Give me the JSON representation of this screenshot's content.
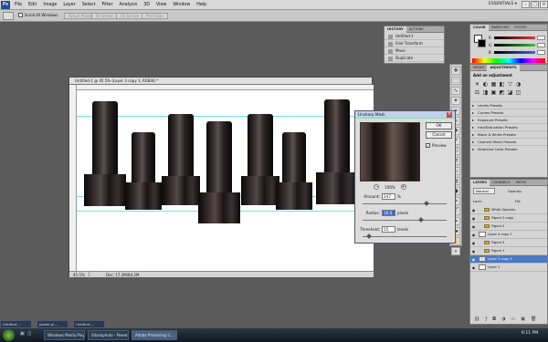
{
  "menubar": {
    "items": [
      "File",
      "Edit",
      "Image",
      "Layer",
      "Select",
      "Filter",
      "Analysis",
      "3D",
      "View",
      "Window",
      "Help"
    ],
    "workspace": "ESSENTIALS ▾"
  },
  "options": {
    "scroll_all": "Scroll All Windows",
    "buttons": [
      "Actual Pixels",
      "Fit Screen",
      "Fill Screen",
      "Print Size"
    ]
  },
  "history": {
    "tabs": [
      "HISTORY",
      "ACTIONS"
    ],
    "rows": [
      "Untitled-1",
      "Free Transform",
      "Move",
      "Duplicate"
    ]
  },
  "color_panel": {
    "tabs": [
      "COLOR",
      "SWATCHES",
      "STYLES"
    ],
    "channels": [
      {
        "label": "R",
        "color": "#e23b3b"
      },
      {
        "label": "G",
        "color": "#3bbf3b"
      },
      {
        "label": "B",
        "color": "#3b62e2"
      }
    ]
  },
  "adjustments": {
    "tabs": [
      "MASKS",
      "ADJUSTMENTS"
    ],
    "title": "Add an adjustment",
    "icons": [
      "☀",
      "◐",
      "▦",
      "◧",
      "▽",
      "◑",
      "⚖",
      "◨",
      "▣",
      "◩",
      "◪",
      "◫"
    ],
    "presets": [
      "Levels Presets",
      "Curves Presets",
      "Exposure Presets",
      "Hue/Saturation Presets",
      "Black & White Presets",
      "Channel Mixer Presets",
      "Selective Color Presets"
    ]
  },
  "layers": {
    "tabs": [
      "LAYERS",
      "CHANNELS",
      "PATHS"
    ],
    "mode": "Normal",
    "opacity_label": "Opacity:",
    "lock_label": "Lock:",
    "fill_label": "Fill:",
    "rows": [
      {
        "name": "White Squares",
        "type": "folder",
        "selected": false
      },
      {
        "name": "Figure 2 copy",
        "type": "folder",
        "selected": false
      },
      {
        "name": "Figure 2",
        "type": "folder",
        "selected": false
      },
      {
        "name": "Layer 4 copy 7",
        "type": "layer",
        "selected": false
      },
      {
        "name": "Figure 5",
        "type": "folder",
        "selected": false
      },
      {
        "name": "Figure 1",
        "type": "folder",
        "selected": false
      },
      {
        "name": "Layer 3 copy 3",
        "type": "layer",
        "selected": true
      },
      {
        "name": "Layer 1",
        "type": "layer",
        "selected": false
      }
    ]
  },
  "document": {
    "title": "Untitled-1 @ 45.5% (Layer 3 copy 3, RGB/8) *",
    "zoom": "45.5%",
    "doc_info": "Doc: 17.2M/84.2M"
  },
  "unsharp": {
    "title": "Unsharp Mask",
    "ok": "OK",
    "cancel": "Cancel",
    "preview_label": "Preview",
    "zoom": "100%",
    "amount_label": "Amount:",
    "amount": "247",
    "amount_unit": "%",
    "radius_label": "Radius:",
    "radius": "10.0",
    "radius_unit": "pixels",
    "threshold_label": "Threshold:",
    "threshold": "15",
    "threshold_unit": "levels"
  },
  "taskbar": {
    "thumbs": [
      "Untitled-...",
      "power-pl...",
      "Untitled-..."
    ],
    "tasks": [
      "Windows Media Player",
      "iStockphoto - Power...",
      "Adobe Photoshop C..."
    ],
    "clock": "6:11 PM"
  }
}
